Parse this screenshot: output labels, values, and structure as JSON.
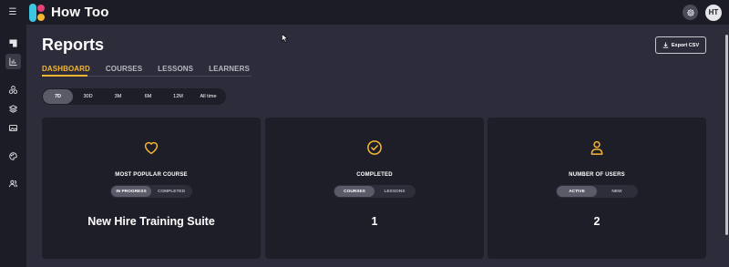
{
  "app": {
    "name": "How Too"
  },
  "user": {
    "initials": "HT"
  },
  "page": {
    "title": "Reports",
    "export_label": "Export CSV"
  },
  "tabs": [
    "DASHBOARD",
    "COURSES",
    "LESSONS",
    "LEARNERS"
  ],
  "ranges": [
    "7D",
    "30D",
    "3M",
    "6M",
    "12M",
    "All time"
  ],
  "selected_range": "7D",
  "cards": [
    {
      "icon": "heart-icon",
      "label": "MOST POPULAR COURSE",
      "toggle": [
        "IN PROGRESS",
        "COMPLETED"
      ],
      "value": "New Hire Training Suite"
    },
    {
      "icon": "check-circle-icon",
      "label": "COMPLETED",
      "toggle": [
        "COURSES",
        "LESSONS"
      ],
      "value": "1"
    },
    {
      "icon": "user-icon",
      "label": "NUMBER OF USERS",
      "toggle": [
        "ACTIVE",
        "NEW"
      ],
      "value": "2"
    }
  ],
  "colors": {
    "accent": "#f5b731",
    "background": "#2c2c3a",
    "panel": "#1e1e28",
    "topbar": "#1c1c26"
  }
}
